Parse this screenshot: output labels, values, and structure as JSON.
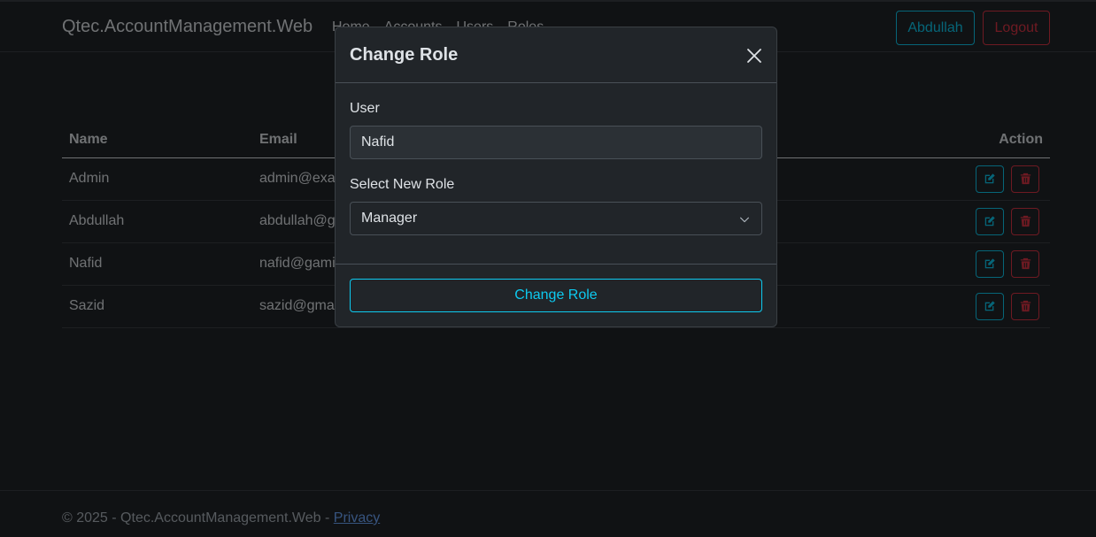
{
  "navbar": {
    "brand": "Qtec.AccountManagement.Web",
    "links": [
      "Home",
      "Accounts",
      "Users",
      "Roles"
    ],
    "user_button": "Abdullah",
    "logout_button": "Logout"
  },
  "table": {
    "headers": {
      "name": "Name",
      "email": "Email",
      "action": "Action"
    },
    "rows": [
      {
        "name": "Admin",
        "email": "admin@exam"
      },
      {
        "name": "Abdullah",
        "email": "abdullah@g"
      },
      {
        "name": "Nafid",
        "email": "nafid@gami"
      },
      {
        "name": "Sazid",
        "email": "sazid@gmai"
      }
    ]
  },
  "footer": {
    "text": "© 2025 - Qtec.AccountManagement.Web - ",
    "privacy_link": "Privacy"
  },
  "modal": {
    "title": "Change Role",
    "user_label": "User",
    "user_value": "Nafid",
    "role_label": "Select New Role",
    "role_value": "Manager",
    "submit_label": "Change Role"
  },
  "colors": {
    "info": "#0dcaf0",
    "danger": "#dc3545",
    "background": "#212529",
    "link": "#6ea8fe"
  }
}
